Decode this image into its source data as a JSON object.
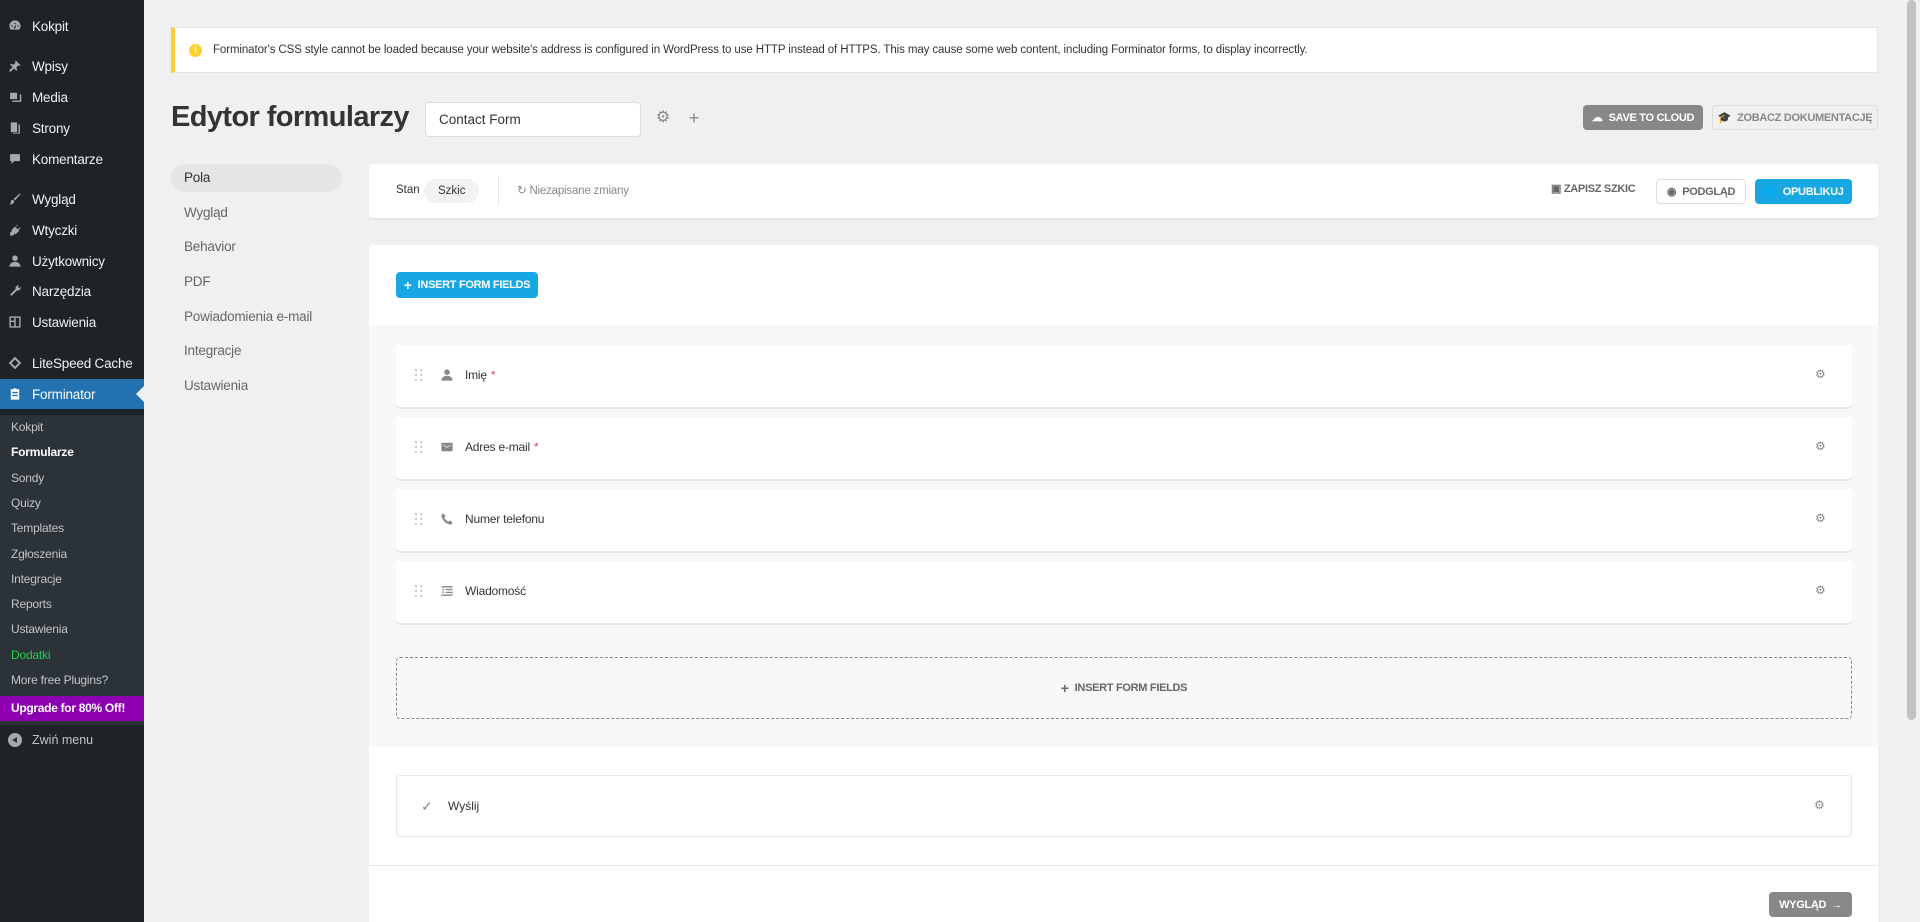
{
  "sidebar": {
    "items": [
      {
        "label": "Kokpit",
        "icon": "dashboard-icon"
      },
      {
        "label": "Wpisy",
        "icon": "pin-icon"
      },
      {
        "label": "Media",
        "icon": "media-icon"
      },
      {
        "label": "Strony",
        "icon": "pages-icon"
      },
      {
        "label": "Komentarze",
        "icon": "comment-icon"
      },
      {
        "label": "Wygląd",
        "icon": "paintbrush-icon"
      },
      {
        "label": "Wtyczki",
        "icon": "plugin-icon"
      },
      {
        "label": "Użytkownicy",
        "icon": "user-icon"
      },
      {
        "label": "Narzędzia",
        "icon": "wrench-icon"
      },
      {
        "label": "Ustawienia",
        "icon": "settings-icon"
      },
      {
        "label": "LiteSpeed Cache",
        "icon": "litespeed-icon"
      },
      {
        "label": "Forminator",
        "icon": "forminator-icon"
      }
    ],
    "submenu": [
      "Kokpit",
      "Formularze",
      "Sondy",
      "Quizy",
      "Templates",
      "Zgłoszenia",
      "Integracje",
      "Reports",
      "Ustawienia",
      "Dodatki",
      "More free Plugins?"
    ],
    "upgrade": "Upgrade for 80% Off!",
    "collapse": "Zwiń menu",
    "colors": {
      "bg": "#1d2327",
      "active": "#2271b1",
      "upgrade": "#8d00b1"
    }
  },
  "notice": {
    "text": "Forminator's CSS style cannot be loaded because your website's address is configured in WordPress to use HTTP instead of HTTPS. This may cause some web content, including Forminator forms, to display incorrectly.",
    "icon": "warning-icon"
  },
  "header": {
    "title": "Edytor formularzy",
    "form_name": "Contact Form",
    "save_cloud": "SAVE TO CLOUD",
    "docs": "ZOBACZ DOKUMENTACJĘ"
  },
  "leftnav": [
    "Pola",
    "Wygląd",
    "Behavior",
    "PDF",
    "Powiadomienia e-mail",
    "Integracje",
    "Ustawienia"
  ],
  "status": {
    "label": "Stan",
    "state": "Szkic",
    "unsaved": "Niezapisane zmiany",
    "save_draft": "ZAPISZ SZKIC",
    "preview": "PODGLĄD",
    "publish": "OPUBLIKUJ"
  },
  "builder": {
    "insert_fields": "INSERT FORM FIELDS",
    "fields": [
      {
        "label": "Imię",
        "required": "*",
        "icon": "user-icon"
      },
      {
        "label": "Adres e-mail",
        "required": "*",
        "icon": "envelope-icon"
      },
      {
        "label": "Numer telefonu",
        "required": "",
        "icon": "phone-icon"
      },
      {
        "label": "Wiadomość",
        "required": "",
        "icon": "textarea-icon"
      }
    ],
    "submit_label": "Wyślij",
    "next": "WYGLĄD",
    "accent": "#17a8e3"
  }
}
